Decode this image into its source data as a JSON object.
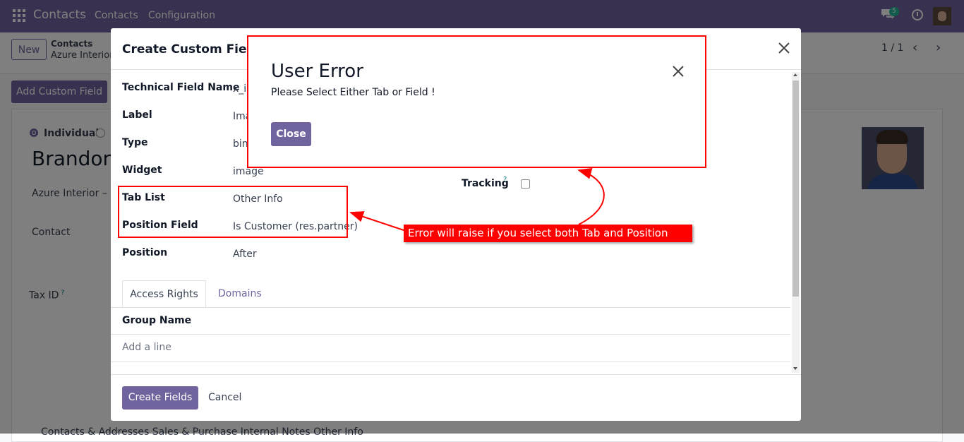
{
  "navbar": {
    "brand": "Contacts",
    "menu": [
      "Contacts",
      "Configuration"
    ],
    "chat_badge": "5"
  },
  "form": {
    "new_button": "New",
    "breadcrumb_parent": "Contacts",
    "breadcrumb_current": "Azure Interior",
    "pager": "1 / 1",
    "add_custom_field": "Add Custom Field",
    "radio_individual": "Individual",
    "partner_name": "Brandon",
    "company_line": "Azure Interior – U",
    "contact_label": "Contact",
    "taxid_label": "Tax ID",
    "taxid_help": "?",
    "bottom_tabs": "Contacts & Addresses    Sales & Purchase    Internal Notes    Other Info"
  },
  "custom_fields_modal": {
    "title": "Create Custom Fields",
    "fields": [
      {
        "label": "Technical Field Name",
        "value": "x_in"
      },
      {
        "label": "Label",
        "value": "Ima"
      },
      {
        "label": "Type",
        "value": "bin"
      },
      {
        "label": "Widget",
        "value": "image"
      },
      {
        "label": "Tab List",
        "value": "Other Info"
      },
      {
        "label": "Position Field",
        "value": "Is Customer (res.partner)"
      },
      {
        "label": "Position",
        "value": "After"
      }
    ],
    "tracking_label": "Tracking",
    "tracking_help": "?",
    "tabs": [
      "Access Rights",
      "Domains"
    ],
    "group_name_header": "Group Name",
    "add_line": "Add a line",
    "create_button": "Create Fields",
    "cancel_button": "Cancel"
  },
  "error_dialog": {
    "title": "User Error",
    "message": "Please Select Either Tab or Field !",
    "close_button": "Close"
  },
  "annotation": {
    "callout_text": "Error will raise if you select both Tab and Position Field"
  },
  "colors": {
    "brand": "#71639e",
    "annotation": "#ff0000"
  }
}
